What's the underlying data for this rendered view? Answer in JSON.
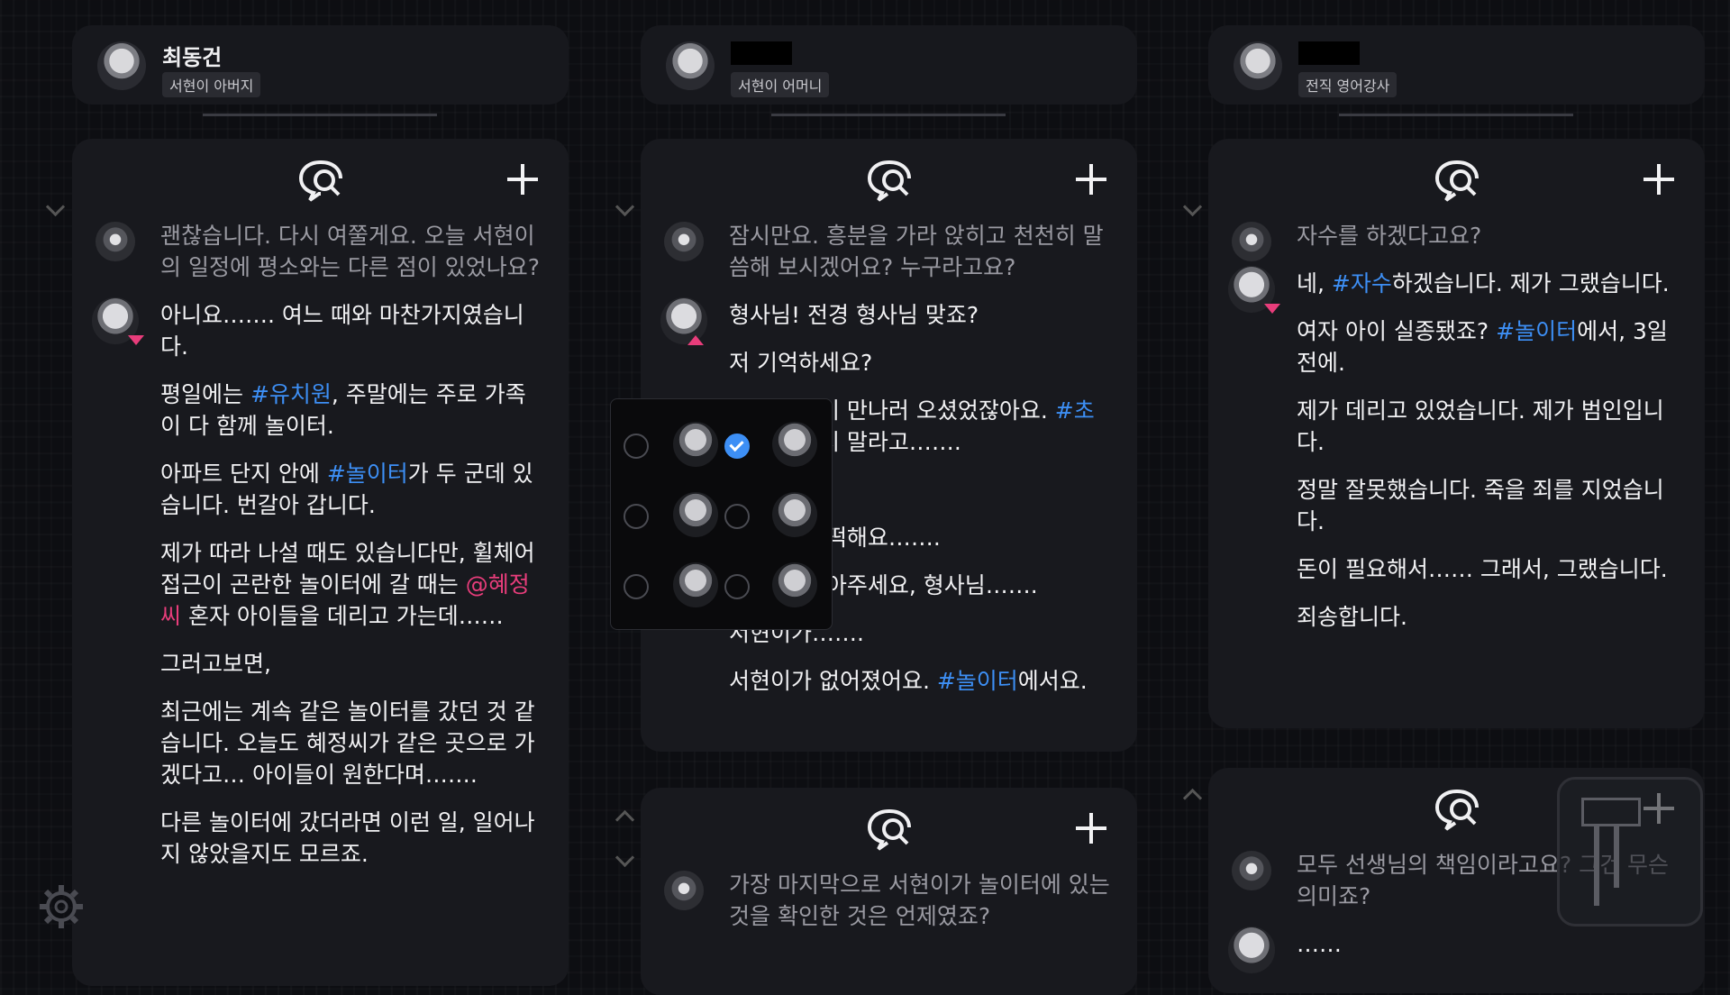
{
  "columns": [
    {
      "header": {
        "name": "최동건",
        "role": "서현이 아버지",
        "name_redacted": false
      },
      "cards": [
        {
          "messages": [
            {
              "speaker": "detective",
              "parts": [
                {
                  "t": "괜찮습니다. 다시 여쭐게요. 오늘 서현이의 일정에 평소와는 다른 점이 있었나요?"
                }
              ]
            },
            {
              "speaker": "suspect",
              "paras": [
                [
                  {
                    "t": "아니요……. 여느 때와 마찬가지였습니다."
                  }
                ],
                [
                  {
                    "t": "평일에는 "
                  },
                  {
                    "t": "#유치원",
                    "k": "tag"
                  },
                  {
                    "t": ", 주말에는 주로 가족이 다 함께 놀이터."
                  }
                ],
                [
                  {
                    "t": "아파트 단지 안에 "
                  },
                  {
                    "t": "#놀이터",
                    "k": "tag"
                  },
                  {
                    "t": "가 두 군데 있습니다. 번갈아 갑니다."
                  }
                ],
                [
                  {
                    "t": "제가 따라 나설 때도 있습니다만, 휠체어 접근이 곤란한 놀이터에 갈 때는 "
                  },
                  {
                    "t": "@혜정씨",
                    "k": "mention"
                  },
                  {
                    "t": " 혼자 아이들을 데리고 가는데……"
                  }
                ],
                [
                  {
                    "t": "그러고보면,"
                  }
                ],
                [
                  {
                    "t": "최근에는 계속 같은 놀이터를 갔던 것 같습니다. 오늘도 혜정씨가 같은 곳으로 가겠다고… 아이들이 원한다며……."
                  }
                ],
                [
                  {
                    "t": "다른 놀이터에 갔더라면 이런 일, 일어나지 않았을지도 모르죠."
                  }
                ]
              ]
            }
          ]
        }
      ]
    },
    {
      "header": {
        "name": "",
        "role": "서현이 어머니",
        "name_redacted": true
      },
      "cards": [
        {
          "messages": [
            {
              "speaker": "detective",
              "parts": [
                {
                  "t": "잠시만요. 흥분을 가라 앉히고 천천히 말씀해 보시겠어요? 누구라고요?"
                }
              ]
            },
            {
              "speaker": "suspect",
              "paras": [
                [
                  {
                    "t": "형사님! 전경 형사님 맞죠?"
                  }
                ],
                [
                  {
                    "t": "저 기억하세요?"
                  }
                ],
                [
                  {
                    "t": "집에 서현이 만나러 오셨었잖아요. "
                  },
                  {
                    "t": "#초인종",
                    "k": "tag"
                  },
                  {
                    "t": " 누르지 말라고……."
                  }
                ],
                [
                  {
                    "t": "……?"
                  }
                ],
                [
                  {
                    "t": "형사님, 어떡해요……."
                  }
                ],
                [
                  {
                    "t": "빨리 좀 찾아주세요, 형사님……."
                  }
                ],
                [
                  {
                    "t": "서현이가……."
                  }
                ],
                [
                  {
                    "t": "서현이가 없어졌어요. "
                  },
                  {
                    "t": "#놀이터",
                    "k": "tag"
                  },
                  {
                    "t": "에서요."
                  }
                ]
              ]
            }
          ]
        },
        {
          "messages": [
            {
              "speaker": "detective",
              "parts": [
                {
                  "t": "가장 마지막으로 서현이가 놀이터에 있는 것을 확인한 것은 언제였죠?"
                }
              ]
            }
          ]
        }
      ]
    },
    {
      "header": {
        "name": "",
        "role": "전직 영어강사",
        "name_redacted": true
      },
      "cards": [
        {
          "messages": [
            {
              "speaker": "detective",
              "parts": [
                {
                  "t": "자수를 하겠다고요?"
                }
              ]
            },
            {
              "speaker": "suspect",
              "paras": [
                [
                  {
                    "t": "네, "
                  },
                  {
                    "t": "#자수",
                    "k": "tag"
                  },
                  {
                    "t": "하겠습니다. 제가 그랬습니다."
                  }
                ],
                [
                  {
                    "t": "여자 아이 실종됐죠? "
                  },
                  {
                    "t": "#놀이터",
                    "k": "tag"
                  },
                  {
                    "t": "에서, 3일 전에."
                  }
                ],
                [
                  {
                    "t": "제가 데리고 있었습니다. 제가 범인입니다."
                  }
                ],
                [
                  {
                    "t": "정말 잘못했습니다. 죽을 죄를 지었습니다."
                  }
                ],
                [
                  {
                    "t": "돈이 필요해서…… 그래서, 그랬습니다."
                  }
                ],
                [
                  {
                    "t": "죄송합니다."
                  }
                ]
              ]
            }
          ]
        },
        {
          "messages": [
            {
              "speaker": "detective",
              "parts": [
                {
                  "t": "모두 선생님의 책임이라고요? 그건 무슨 의미죠?"
                }
              ]
            },
            {
              "speaker": "suspect",
              "paras": [
                [
                  {
                    "t": "……"
                  }
                ]
              ]
            }
          ]
        }
      ]
    }
  ],
  "popup": {
    "options": [
      {
        "checked": false
      },
      {
        "checked": true
      },
      {
        "checked": false
      },
      {
        "checked": false
      },
      {
        "checked": false
      },
      {
        "checked": false
      }
    ]
  },
  "icons": {
    "talk": "speech-bubble-search-icon",
    "add": "plus-icon",
    "settings": "gear-icon"
  },
  "colors": {
    "tag": "#3d8ff5",
    "mention": "#e83d7b",
    "panel": "#18191e",
    "background": "#0d0e12"
  }
}
